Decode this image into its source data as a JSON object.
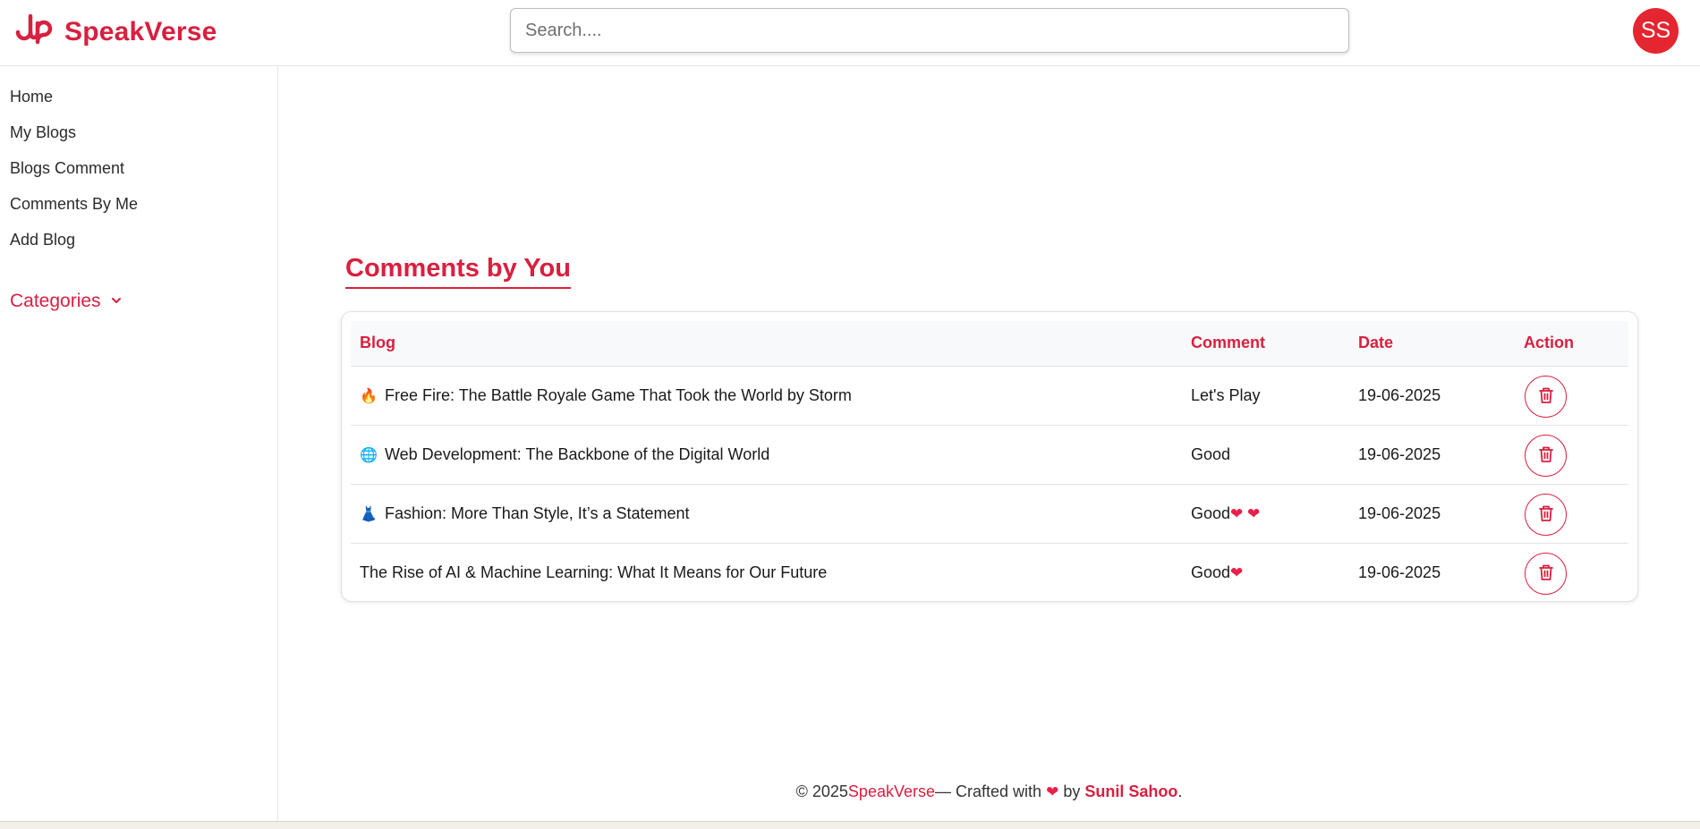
{
  "brand": {
    "name": "SpeakVerse",
    "logo_icon": "speakverse-logo-icon",
    "color": "#d8203f"
  },
  "search": {
    "placeholder": "Search....",
    "value": ""
  },
  "user": {
    "initials": "SS",
    "avatar_color": "#e3262f"
  },
  "sidebar": {
    "items": [
      {
        "label": "Home"
      },
      {
        "label": "My Blogs"
      },
      {
        "label": "Blogs Comment"
      },
      {
        "label": "Comments By Me"
      },
      {
        "label": "Add Blog"
      }
    ],
    "categories_label": "Categories",
    "categories_icon": "chevron-down-icon"
  },
  "main": {
    "title": "Comments by You",
    "table": {
      "headers": {
        "blog": "Blog",
        "comment": "Comment",
        "date": "Date",
        "action": "Action"
      },
      "rows": [
        {
          "emoji": "🔥",
          "blog": "Free Fire: The Battle Royale Game That Took the World by Storm",
          "comment": "Let's Play",
          "hearts": "",
          "date": "19-06-2025",
          "action_icon": "trash-icon"
        },
        {
          "emoji": "🌐",
          "blog": "Web Development: The Backbone of the Digital World",
          "comment": "Good",
          "hearts": "",
          "date": "19-06-2025",
          "action_icon": "trash-icon"
        },
        {
          "emoji": "👗",
          "blog": "Fashion: More Than Style, It’s a Statement",
          "comment": "Good",
          "hearts": "❤ ❤",
          "date": "19-06-2025",
          "action_icon": "trash-icon"
        },
        {
          "emoji": "",
          "blog": "The Rise of AI & Machine Learning: What It Means for Our Future",
          "comment": "Good",
          "hearts": "❤",
          "date": "19-06-2025",
          "action_icon": "trash-icon"
        }
      ]
    }
  },
  "footer": {
    "prefix": "© 2025",
    "brand": "SpeakVerse",
    "crafted": "— Crafted with",
    "heart": "❤",
    "by": "by",
    "author": "Sunil Sahoo",
    "suffix": "."
  }
}
